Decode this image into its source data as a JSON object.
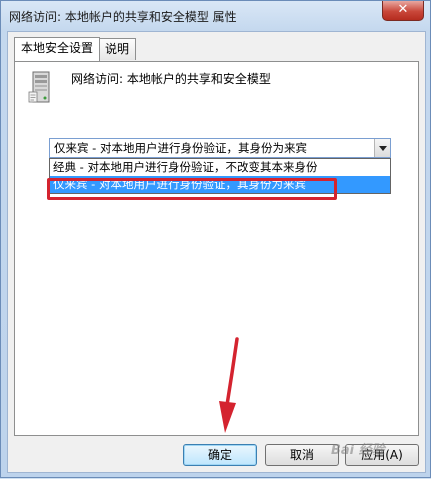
{
  "window": {
    "title": "网络访问: 本地帐户的共享和安全模型 属性",
    "close_glyph": "✕"
  },
  "tabs": [
    {
      "label": "本地安全设置",
      "active": true
    },
    {
      "label": "说明",
      "active": false
    }
  ],
  "policy": {
    "icon": "server-icon",
    "title": "网络访问: 本地帐户的共享和安全模型"
  },
  "dropdown": {
    "selected_value": "仅来宾 - 对本地用户进行身份验证，其身份为来宾",
    "options": [
      "经典 - 对本地用户进行身份验证，不改变其本来身份",
      "仅来宾 - 对本地用户进行身份验证，其身份为来宾"
    ],
    "highlighted_index": 1
  },
  "buttons": {
    "ok": "确定",
    "cancel": "取消",
    "apply": "应用(A)"
  },
  "annotation": {
    "highlight_color": "#d4232f"
  },
  "watermark": "Bai 经验"
}
